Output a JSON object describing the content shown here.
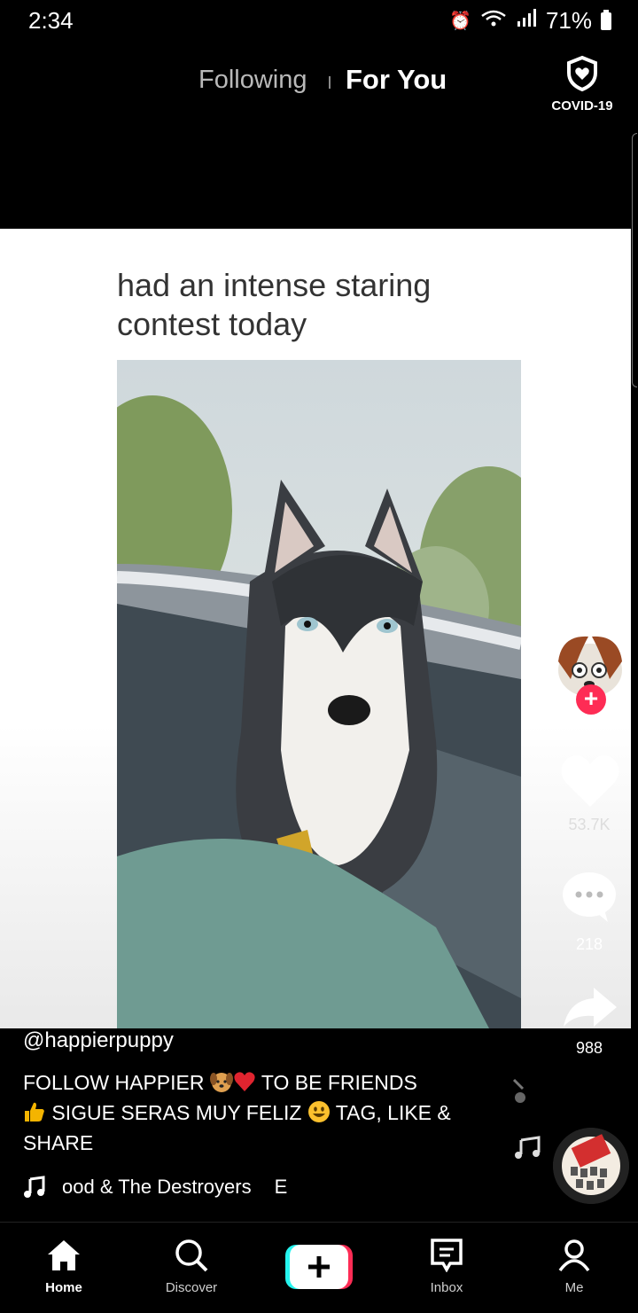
{
  "status_bar": {
    "time": "2:34",
    "battery": "71%"
  },
  "top_nav": {
    "following": "Following",
    "for_you": "For You",
    "covid": "COVID-19"
  },
  "video": {
    "caption_line1": "had an intense staring",
    "caption_line2": "contest today"
  },
  "actions": {
    "likes": "53.7K",
    "comments": "218",
    "shares": "988"
  },
  "post": {
    "username": "@happierpuppy",
    "desc_part1": "FOLLOW HAPPIER",
    "desc_part2": "TO BE FRIENDS",
    "desc_part3": "SIGUE SERAS MUY FELIZ",
    "desc_part4": "TAG, LIKE &",
    "desc_part5": "SHARE",
    "music": "ood & The Destroyers",
    "music_trail": "E"
  },
  "bottom_nav": {
    "home": "Home",
    "discover": "Discover",
    "inbox": "Inbox",
    "me": "Me"
  },
  "colors": {
    "accent": "#fe2c55",
    "create_cyan": "#25f4ee",
    "background": "#000000"
  }
}
